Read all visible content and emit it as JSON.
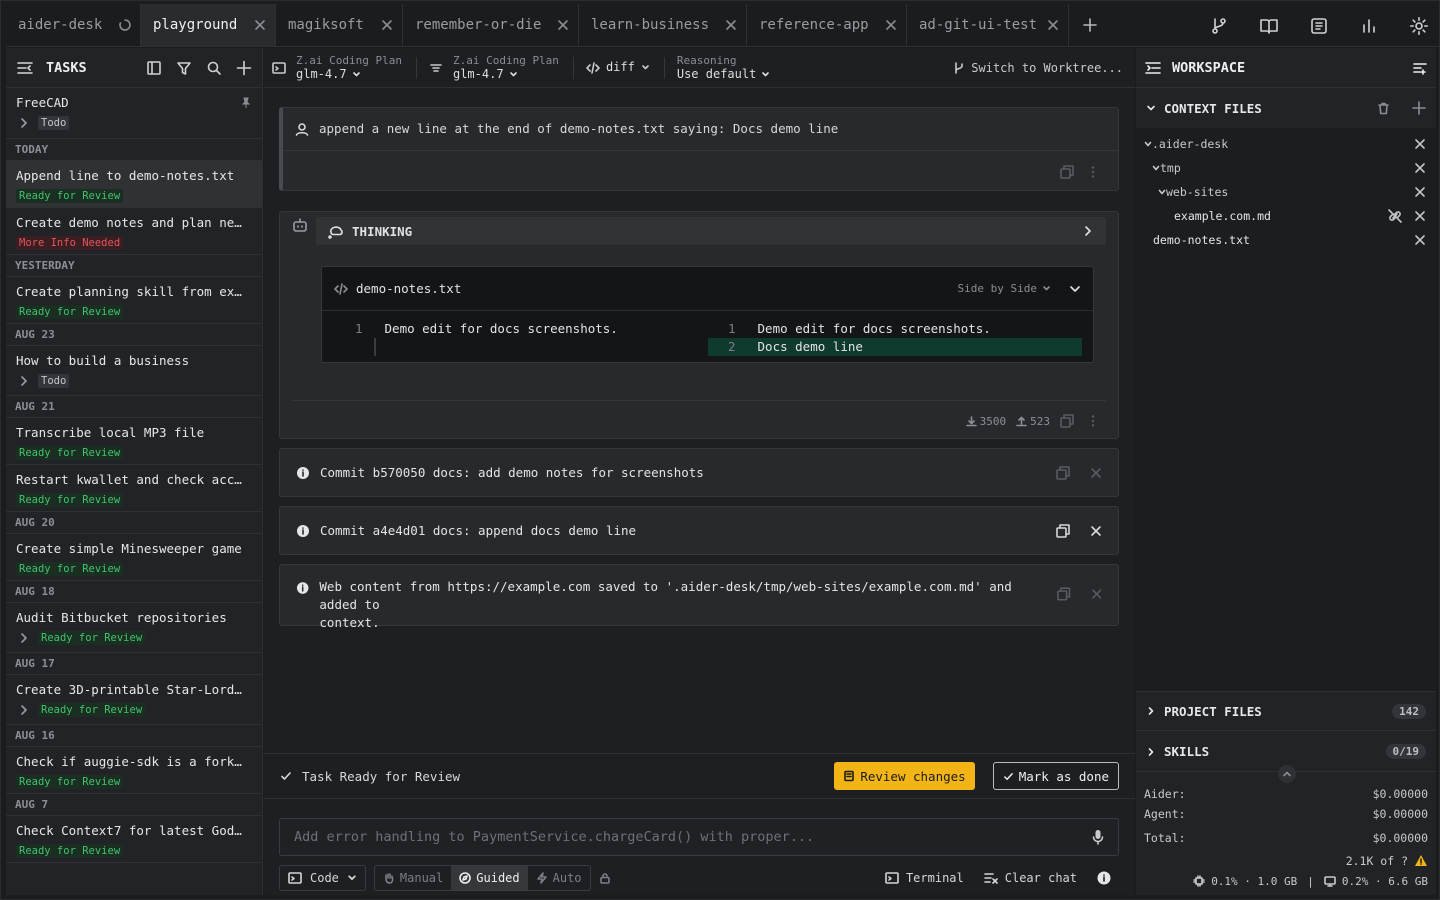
{
  "tabs": [
    {
      "label": "aider-desk"
    },
    {
      "label": "playground"
    },
    {
      "label": "magiksoft"
    },
    {
      "label": "remember-or-die"
    },
    {
      "label": "learn-business"
    },
    {
      "label": "reference-app"
    },
    {
      "label": "ad-git-ui-test"
    }
  ],
  "sidebar": {
    "title": "TASKS",
    "pinned": {
      "name": "FreeCAD",
      "status": "Todo"
    },
    "groups": [
      {
        "label": "TODAY",
        "tasks": [
          {
            "name": "Append line to demo-notes.txt",
            "status": "Ready for Review"
          },
          {
            "name": "Create demo notes and plan next steps",
            "status": "More Info Needed"
          }
        ]
      },
      {
        "label": "YESTERDAY",
        "tasks": [
          {
            "name": "Create planning skill from existing docs",
            "status": "Ready for Review"
          }
        ]
      },
      {
        "label": "AUG 23",
        "tasks": [
          {
            "name": "How to build a business",
            "status": "Todo"
          }
        ]
      },
      {
        "label": "AUG 21",
        "tasks": [
          {
            "name": "Transcribe local MP3 file",
            "status": "Ready for Review"
          },
          {
            "name": "Restart kwallet and check accounts",
            "status": "Ready for Review"
          }
        ]
      },
      {
        "label": "AUG 20",
        "tasks": [
          {
            "name": "Create simple Minesweeper game",
            "status": "Ready for Review"
          }
        ]
      },
      {
        "label": "AUG 18",
        "tasks": [
          {
            "name": "Audit Bitbucket repositories",
            "status": "Ready for Review"
          }
        ]
      },
      {
        "label": "AUG 17",
        "tasks": [
          {
            "name": "Create 3D-printable Star-Lord mask",
            "status": "Ready for Review"
          }
        ]
      },
      {
        "label": "AUG 16",
        "tasks": [
          {
            "name": "Check if auggie-sdk is a fork of another project",
            "status": "Ready for Review"
          }
        ]
      },
      {
        "label": "AUG 7",
        "tasks": [
          {
            "name": "Check Context7 for latest Godot docs",
            "status": "Ready for Review"
          }
        ]
      }
    ]
  },
  "model_bar": {
    "main_label": "Z.ai Coding Plan",
    "main_model": "glm-4.7",
    "weak_label": "Z.ai Coding Plan",
    "weak_model": "glm-4.7",
    "edit_format": "diff",
    "reasoning_label": "Reasoning",
    "reasoning_value": "Use default",
    "worktree": "Switch to Worktree..."
  },
  "messages": {
    "user_prompt": "append a new line at the end of demo-notes.txt saying: Docs demo line",
    "thinking": "THINKING",
    "diff": {
      "file": "demo-notes.txt",
      "view_mode": "Side by Side",
      "left": [
        {
          "num": "1",
          "text": "Demo edit for docs screenshots."
        }
      ],
      "right": [
        {
          "num": "1",
          "text": "Demo edit for docs screenshots."
        },
        {
          "num": "2",
          "text": "Docs demo line"
        }
      ]
    },
    "tokens_in": "3500",
    "tokens_out": "523",
    "commit1": "Commit b570050 docs: add demo notes for screenshots",
    "commit2": "Commit a4e4d01 docs: append docs demo line",
    "web_line1": "Web content from https://example.com saved to '.aider-desk/tmp/web-sites/example.com.md' and added to",
    "web_line2": "context."
  },
  "bottom": {
    "status": "Task Ready for Review",
    "review_label": "Review changes",
    "done_label": "Mark as done",
    "prompt_placeholder": "Add error handling to PaymentService.chargeCard() with proper...",
    "mode": "Code",
    "modes": [
      "Manual",
      "Guided",
      "Auto"
    ],
    "terminal": "Terminal",
    "clear": "Clear chat"
  },
  "workspace": {
    "title": "WORKSPACE",
    "context_title": "CONTEXT FILES",
    "tree": [
      ".aider-desk",
      "tmp",
      "web-sites",
      "example.com.md",
      "demo-notes.txt"
    ],
    "project_files": "PROJECT FILES",
    "project_count": "142",
    "skills": "SKILLS",
    "skills_count": "0/19",
    "aider_label": "Aider:",
    "aider_cost": "$0.00000",
    "agent_label": "Agent:",
    "agent_cost": "$0.00000",
    "total_label": "Total:",
    "total_cost": "$0.00000",
    "tokens": "2.1K of ?",
    "usage_cpu": "0.1% · 1.0 GB",
    "usage_mem": "0.2% · 6.6 GB",
    "usage_sep": "|"
  },
  "colors": {
    "accent": "#f2b515",
    "ready": "#44c26f",
    "info_needed": "#e0565f",
    "added_line": "#0f3a2f"
  }
}
